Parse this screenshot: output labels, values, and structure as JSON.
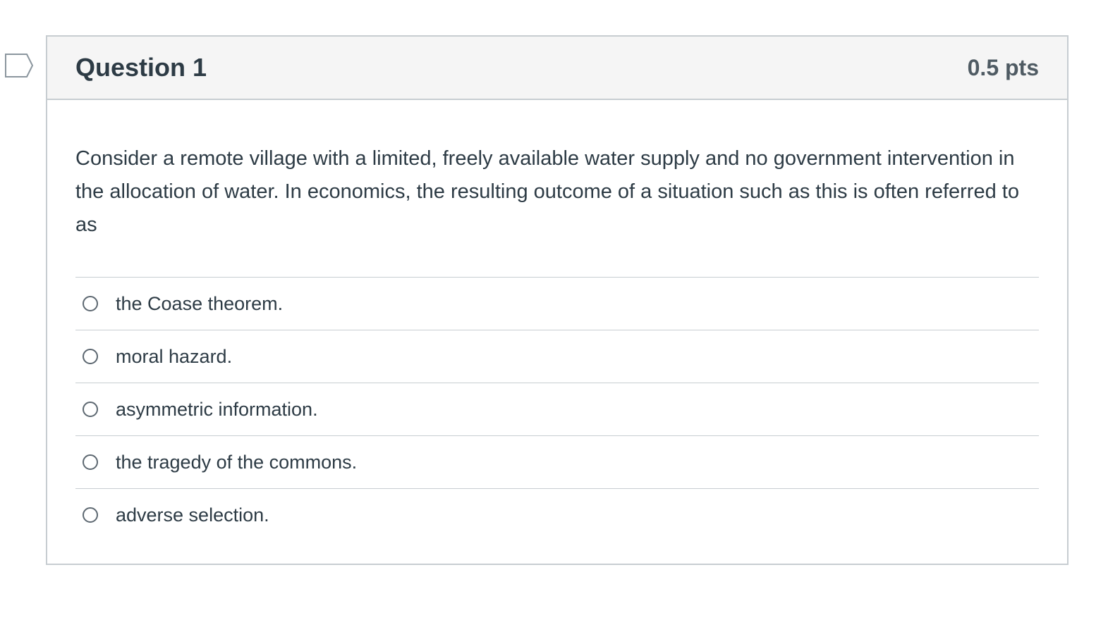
{
  "question": {
    "title": "Question 1",
    "points": "0.5 pts",
    "text": "Consider a remote village with a limited, freely available water supply and no government intervention in the allocation of water. In economics, the resulting outcome of a situation such as this is often referred to as",
    "answers": [
      {
        "label": "the Coase theorem."
      },
      {
        "label": "moral hazard."
      },
      {
        "label": "asymmetric information."
      },
      {
        "label": "the tragedy of the commons."
      },
      {
        "label": "adverse selection."
      }
    ]
  },
  "colors": {
    "text": "#2d3b45",
    "border": "#c7cdd1",
    "header_bg": "#f5f5f5",
    "flag_stroke": "#8b969e"
  },
  "icons": {
    "flag": "flag-question-icon",
    "radio": "radio-button-icon"
  }
}
